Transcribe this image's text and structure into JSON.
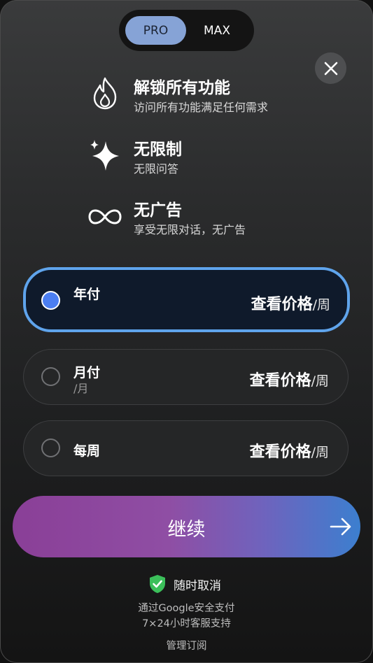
{
  "tabs": {
    "pro": "PRO",
    "max": "MAX"
  },
  "features": [
    {
      "icon": "flame-icon",
      "title": "解锁所有功能",
      "subtitle": "访问所有功能满足任何需求"
    },
    {
      "icon": "sparkle-icon",
      "title": "无限制",
      "subtitle": "无限问答"
    },
    {
      "icon": "infinity-icon",
      "title": "无广告",
      "subtitle": "享受无限对话，无广告"
    }
  ],
  "plans": [
    {
      "name": "年付",
      "sub": "",
      "price": "查看价格",
      "unit": "/周",
      "selected": true
    },
    {
      "name": "月付",
      "sub": "/月",
      "price": "查看价格",
      "unit": "/周",
      "selected": false
    },
    {
      "name": "每周",
      "sub": "",
      "price": "查看价格",
      "unit": "/周",
      "selected": false
    }
  ],
  "continue_label": "继续",
  "cancel_anytime": "随时取消",
  "secure_pay": "通过Google安全支付",
  "support": "7×24小时客服支持",
  "manage": "管理订阅",
  "colors": {
    "selected_border": "#5fa4ec",
    "radio_fill": "#4b7ef1",
    "shield": "#3bbf5a"
  }
}
